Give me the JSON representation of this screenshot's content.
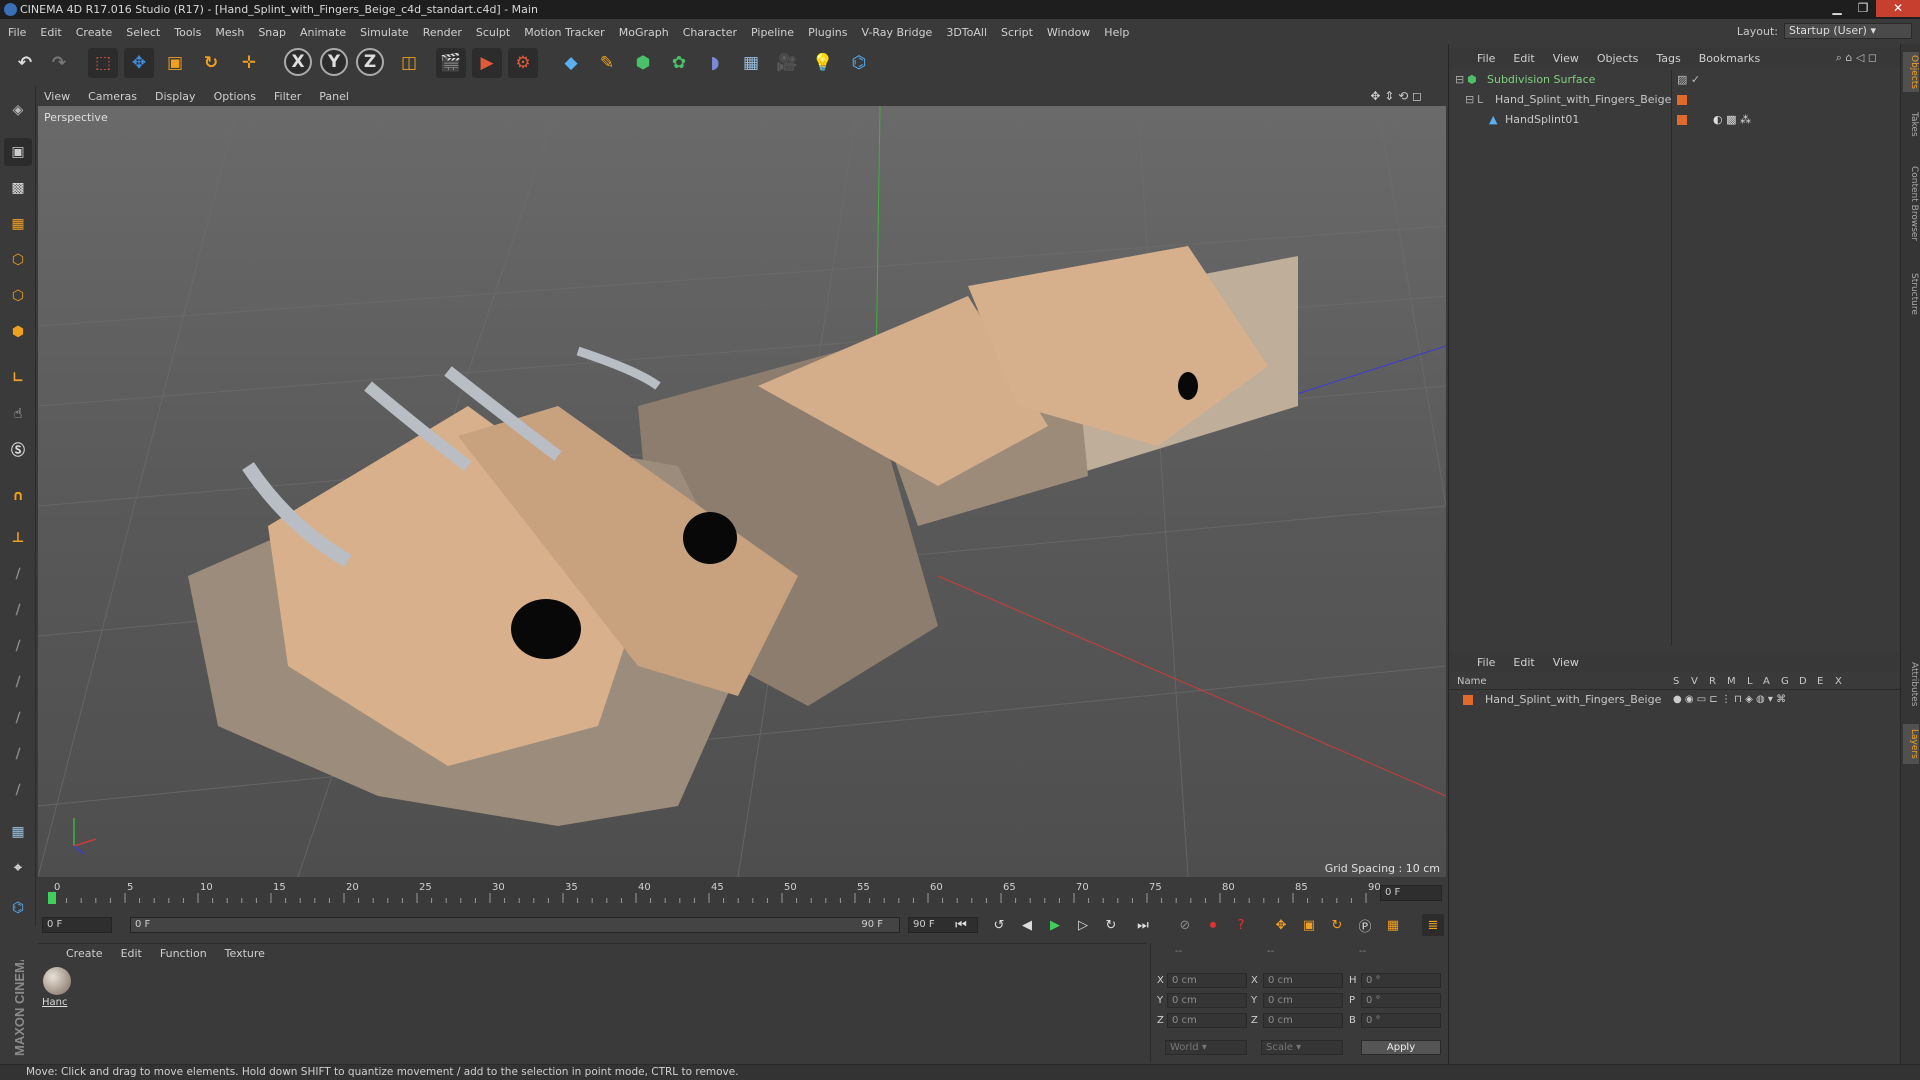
{
  "window": {
    "title": "CINEMA 4D R17.016 Studio (R17) - [Hand_Splint_with_Fingers_Beige_c4d_standart.c4d] - Main"
  },
  "menubar": {
    "items": [
      "File",
      "Edit",
      "Create",
      "Select",
      "Tools",
      "Mesh",
      "Snap",
      "Animate",
      "Simulate",
      "Render",
      "Sculpt",
      "Motion Tracker",
      "MoGraph",
      "Character",
      "Pipeline",
      "Plugins",
      "V-Ray Bridge",
      "3DToAll",
      "Script",
      "Window",
      "Help"
    ]
  },
  "layout": {
    "label": "Layout:",
    "value": "Startup (User)"
  },
  "toolbar": {
    "icons": [
      "undo-icon",
      "redo-icon",
      "live-select-icon",
      "move-icon",
      "scale-icon",
      "rotate-icon",
      "transform-icon",
      "x-axis-icon",
      "y-axis-icon",
      "z-axis-icon",
      "coordinate-system-icon",
      "render-view-icon",
      "render-picture-viewer-icon",
      "render-settings-icon",
      "cube-icon",
      "pen-spline-icon",
      "subdivision-icon",
      "array-icon",
      "deformer-icon",
      "floor-icon",
      "camera-icon",
      "light-icon",
      "python-icon"
    ],
    "axis_labels": [
      "X",
      "Y",
      "Z"
    ]
  },
  "viewport": {
    "menu": [
      "View",
      "Cameras",
      "Display",
      "Options",
      "Filter",
      "Panel"
    ],
    "camera_label": "Perspective",
    "grid_spacing": "Grid Spacing : 10 cm"
  },
  "timeline": {
    "ticks": [
      "0",
      "5",
      "10",
      "15",
      "20",
      "25",
      "30",
      "35",
      "40",
      "45",
      "50",
      "55",
      "60",
      "65",
      "70",
      "75",
      "80",
      "85",
      "90"
    ],
    "current_frame": "0 F",
    "start_field": "0 F",
    "range_start": "0 F",
    "range_end": "90 F",
    "end_field": "90 F"
  },
  "material_manager": {
    "menu": [
      "Create",
      "Edit",
      "Function",
      "Texture"
    ],
    "materials": [
      {
        "label": "Hanc"
      }
    ]
  },
  "coordinates": {
    "header": [
      "--",
      "--",
      "--"
    ],
    "rows": [
      {
        "pos_label": "X",
        "pos": "0 cm",
        "size_label": "X",
        "size": "0 cm",
        "rot_label": "H",
        "rot": "0 °"
      },
      {
        "pos_label": "Y",
        "pos": "0 cm",
        "size_label": "Y",
        "size": "0 cm",
        "rot_label": "P",
        "rot": "0 °"
      },
      {
        "pos_label": "Z",
        "pos": "0 cm",
        "size_label": "Z",
        "size": "0 cm",
        "rot_label": "B",
        "rot": "0 °"
      }
    ],
    "mode": "World",
    "scale": "Scale",
    "apply": "Apply"
  },
  "object_manager": {
    "menu": [
      "File",
      "Edit",
      "View",
      "Objects",
      "Tags",
      "Bookmarks"
    ],
    "objects": [
      {
        "name": "Subdivision Surface"
      },
      {
        "name": "Hand_Splint_with_Fingers_Beige"
      },
      {
        "name": "HandSplint01"
      }
    ]
  },
  "layer_manager": {
    "menu": [
      "File",
      "Edit",
      "View"
    ],
    "columns": [
      "Name",
      "S",
      "V",
      "R",
      "M",
      "L",
      "A",
      "G",
      "D",
      "E",
      "X"
    ],
    "layers": [
      {
        "name": "Hand_Splint_with_Fingers_Beige",
        "color": "#e06a2a"
      }
    ]
  },
  "side_tabs": [
    "Objects",
    "Takes",
    "Content Browser",
    "Structure",
    "Attributes",
    "Layers"
  ],
  "status": {
    "text": "Move: Click and drag to move elements. Hold down SHIFT to quantize movement / add to the selection in point mode, CTRL to remove."
  },
  "brand": {
    "vertical": "MAXON CINEMA 4D"
  },
  "colors": {
    "accent_blue": "#3d8be0",
    "object_orange": "#e06a2a",
    "splint_beige": "#d9b18f"
  }
}
